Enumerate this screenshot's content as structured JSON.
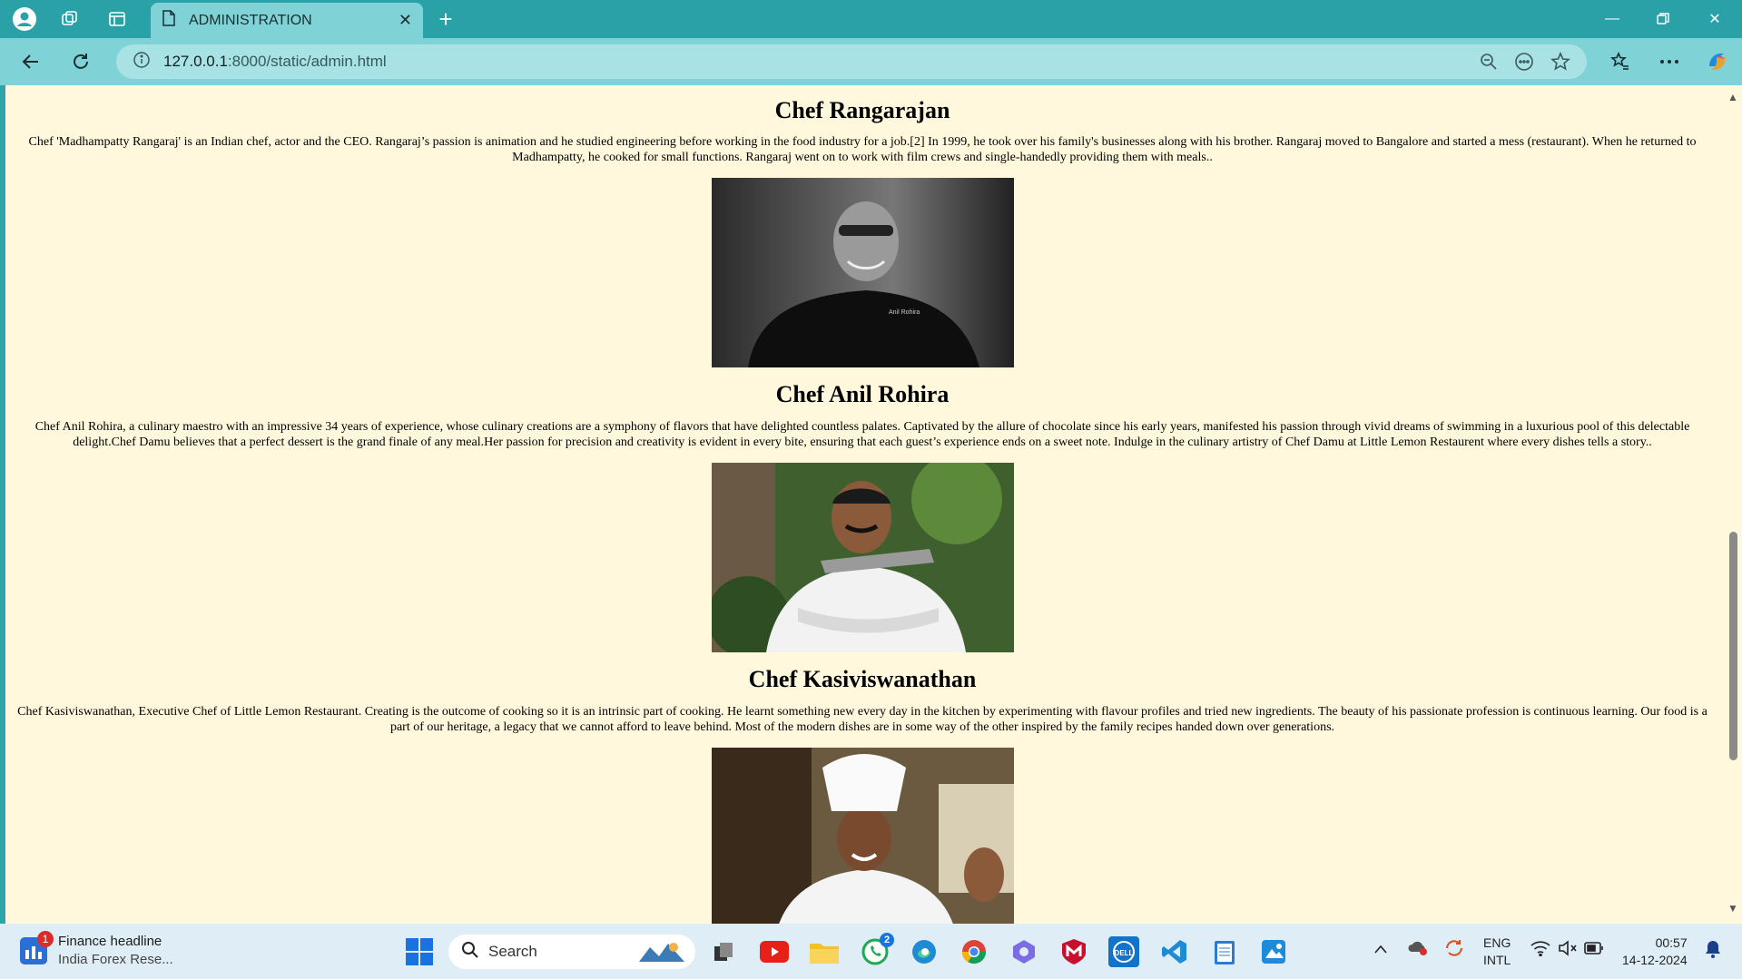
{
  "browser": {
    "tab_title": "ADMINISTRATION",
    "url_host": "127.0.0.1",
    "url_path": ":8000/static/admin.html"
  },
  "chefs": [
    {
      "name": "Chef Rangarajan",
      "bio": "Chef 'Madhampatty Rangaraj' is an Indian chef, actor and the CEO. Rangaraj’s passion is animation and he studied engineering before working in the food industry for a job.[2] In 1999, he took over his family's businesses along with his brother. Rangaraj moved to Bangalore and started a mess (restaurant). When he returned to Madhampatty, he cooked for small functions. Rangaraj went on to work with film crews and single-handedly providing them with meals.."
    },
    {
      "name": "Chef Anil Rohira",
      "bio": "Chef Anil Rohira, a culinary maestro with an impressive 34 years of experience, whose culinary creations are a symphony of flavors that have delighted countless palates. Captivated by the allure of chocolate since his early years, manifested his passion through vivid dreams of swimming in a luxurious pool of this delectable delight.Chef Damu believes that a perfect dessert is the grand finale of any meal.Her passion for precision and creativity is evident in every bite, ensuring that each guest’s experience ends on a sweet note. Indulge in the culinary artistry of Chef Damu at Little Lemon Restaurent where every dishes tells a story..",
      "jacket_text": "Anil Rohira"
    },
    {
      "name": "Chef Kasiviswanathan",
      "bio": "Chef Kasiviswanathan, Executive Chef of Little Lemon Restaurant. Creating is the outcome of cooking so it is an intrinsic part of cooking. He learnt something new every day in the kitchen by experimenting with flavour profiles and tried new ingredients. The beauty of his passionate profession is continuous learning. Our food is a part of our heritage, a legacy that we cannot afford to leave behind. Most of the modern dishes are in some way of the other inspired by the family recipes handed down over generations."
    }
  ],
  "taskbar": {
    "news_title": "Finance headline",
    "news_sub": "India Forex Rese...",
    "news_badge": "1",
    "search_label": "Search",
    "whatsapp_badge": "2",
    "lang_line1": "ENG",
    "lang_line2": "INTL",
    "time": "00:57",
    "date": "14-12-2024"
  },
  "colors": {
    "frame": "#2aa1a6",
    "toolbar": "#7fd3d6",
    "page_bg": "#fff8dc"
  }
}
